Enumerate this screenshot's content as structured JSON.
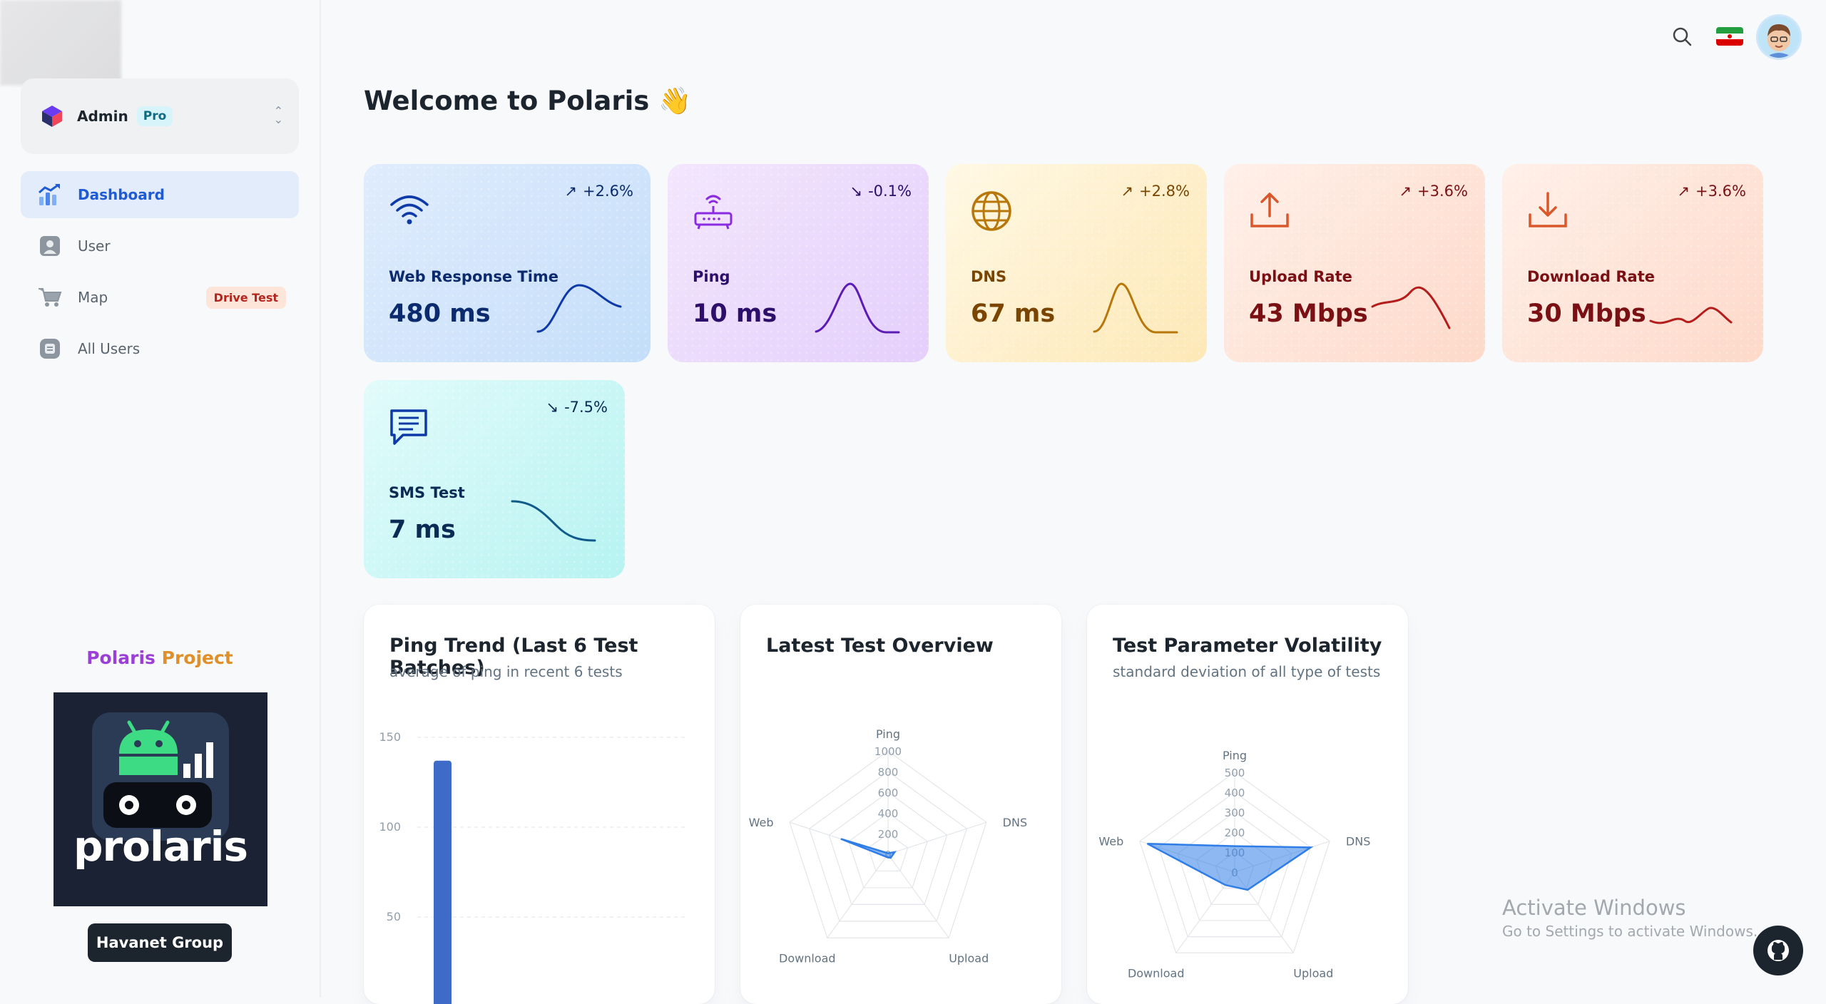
{
  "sidebar": {
    "workspace": {
      "name": "Admin",
      "badge": "Pro"
    },
    "items": [
      {
        "label": "Dashboard",
        "icon": "chart-icon",
        "active": true
      },
      {
        "label": "User",
        "icon": "user-icon"
      },
      {
        "label": "Map",
        "icon": "cart-icon",
        "badge": "Drive Test"
      },
      {
        "label": "All Users",
        "icon": "users-icon"
      }
    ],
    "project_title_part1": "Polaris ",
    "project_title_part2": "Project",
    "app_name": "prolaris",
    "group_button": "Havanet Group"
  },
  "header": {
    "title": "Welcome to Polaris",
    "wave_emoji": "👋"
  },
  "cards": [
    {
      "label": "Web Response Time",
      "value": "480 ms",
      "trend": "+2.6%",
      "trend_dir": "up",
      "color": "#0d3aa8"
    },
    {
      "label": "Ping",
      "value": "10 ms",
      "trend": "-0.1%",
      "trend_dir": "down",
      "color": "#5b1bb5"
    },
    {
      "label": "DNS",
      "value": "67 ms",
      "trend": "+2.8%",
      "trend_dir": "up",
      "color": "#b7770a"
    },
    {
      "label": "Upload Rate",
      "value": "43 Mbps",
      "trend": "+3.6%",
      "trend_dir": "up",
      "color": "#b51d1d"
    },
    {
      "label": "Download Rate",
      "value": "30 Mbps",
      "trend": "+3.6%",
      "trend_dir": "up",
      "color": "#b51d1d"
    },
    {
      "label": "SMS Test",
      "value": "7 ms",
      "trend": "-7.5%",
      "trend_dir": "down",
      "color": "#0f5a8a"
    }
  ],
  "panels": [
    {
      "title": "Ping Trend (Last 6 Test Batches)",
      "subtitle": "average of ping in recent 6 tests"
    },
    {
      "title": "Latest Test Overview",
      "subtitle": ""
    },
    {
      "title": "Test Parameter Volatility",
      "subtitle": "standard deviation of all type of tests"
    }
  ],
  "chart_data": [
    {
      "type": "bar",
      "title": "Ping Trend (Last 6 Test Batches)",
      "yticks": [
        150,
        100,
        50
      ],
      "ylim": [
        0,
        150
      ],
      "values": [
        137
      ],
      "color": "#3e6bc7"
    },
    {
      "type": "radar",
      "title": "Latest Test Overview",
      "axes": [
        "Ping",
        "DNS",
        "Upload",
        "Download",
        "Web"
      ],
      "ticks": [
        1000,
        800,
        600,
        400,
        200,
        0
      ],
      "rmax": 1000,
      "values": [
        10,
        67,
        43,
        30,
        480
      ],
      "color": "#2f7de6"
    },
    {
      "type": "radar",
      "title": "Test Parameter Volatility",
      "axes": [
        "Ping",
        "DNS",
        "Upload",
        "Download",
        "Web"
      ],
      "ticks": [
        500,
        400,
        300,
        200,
        100,
        0
      ],
      "rmax": 500,
      "values": [
        130,
        400,
        110,
        80,
        460
      ],
      "color": "#2f7de6"
    }
  ],
  "windows_watermark": {
    "line1": "Activate Windows",
    "line2": "Go to Settings to activate Windows."
  }
}
